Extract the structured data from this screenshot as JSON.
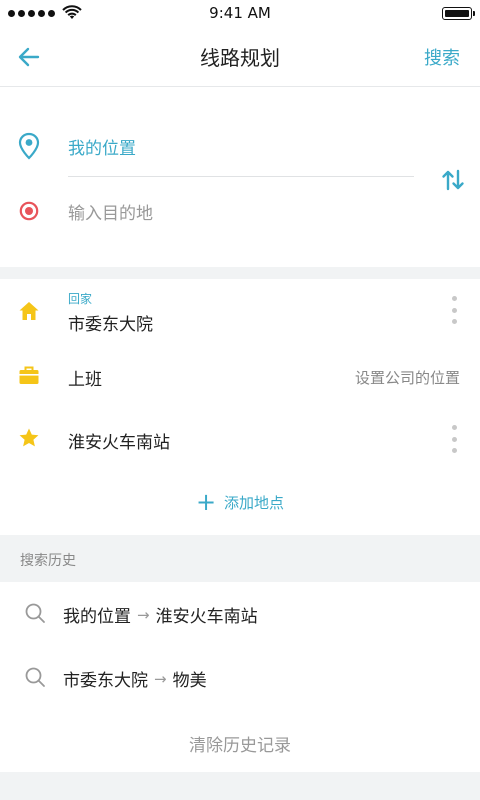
{
  "status_bar": {
    "time": "9:41 AM"
  },
  "nav": {
    "title": "线路规划",
    "search_label": "搜索",
    "back_icon": "arrow-left-icon"
  },
  "route": {
    "origin": "我的位置",
    "destination_placeholder": "输入目的地",
    "swap_icon": "swap-vertical-icon"
  },
  "favorites": {
    "home": {
      "tag": "回家",
      "name": "市委东大院"
    },
    "work": {
      "name": "上班",
      "action": "设置公司的位置"
    },
    "starred": {
      "name": "淮安火车南站"
    },
    "add_label": "添加地点"
  },
  "history": {
    "title": "搜索历史",
    "items": [
      {
        "from": "我的位置",
        "to": "淮安火车南站"
      },
      {
        "from": "市委东大院",
        "to": "物美"
      }
    ],
    "clear_label": "清除历史记录"
  },
  "colors": {
    "accent": "#3aa9c8",
    "destination_marker": "#e8545a",
    "home_icon": "#f5c518",
    "work_icon": "#f5c518",
    "star_icon": "#f5c518"
  }
}
